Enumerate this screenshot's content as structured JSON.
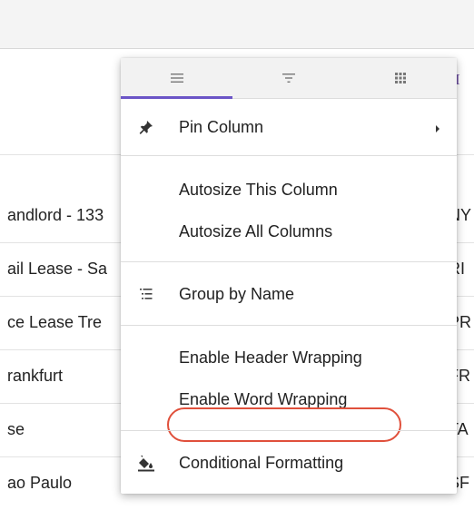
{
  "grid": {
    "header_right_text": "t I",
    "rows": [
      {
        "left": "andlord - 133",
        "right": "NY"
      },
      {
        "left": "ail Lease - Sa",
        "right": "RI"
      },
      {
        "left": "ce Lease Tre",
        "right": "PR"
      },
      {
        "left": "rankfurt",
        "right": "FR"
      },
      {
        "left": "se",
        "right": "TA"
      },
      {
        "left": "ao Paulo",
        "right": "SF"
      }
    ]
  },
  "menu": {
    "tabs": [
      {
        "icon": "menu-lines-icon",
        "active": true
      },
      {
        "icon": "filter-icon",
        "active": false
      },
      {
        "icon": "columns-grid-icon",
        "active": false
      }
    ],
    "items": {
      "pin_column": "Pin Column",
      "autosize_this": "Autosize This Column",
      "autosize_all": "Autosize All Columns",
      "group_by": "Group by Name",
      "header_wrapping": "Enable Header Wrapping",
      "word_wrapping": "Enable Word Wrapping",
      "conditional_formatting": "Conditional Formatting"
    },
    "highlighted_item": "Enable Word Wrapping"
  },
  "colors": {
    "accent": "#6b55c7",
    "highlight": "#e0503b",
    "header_text": "#6a4aa0"
  }
}
